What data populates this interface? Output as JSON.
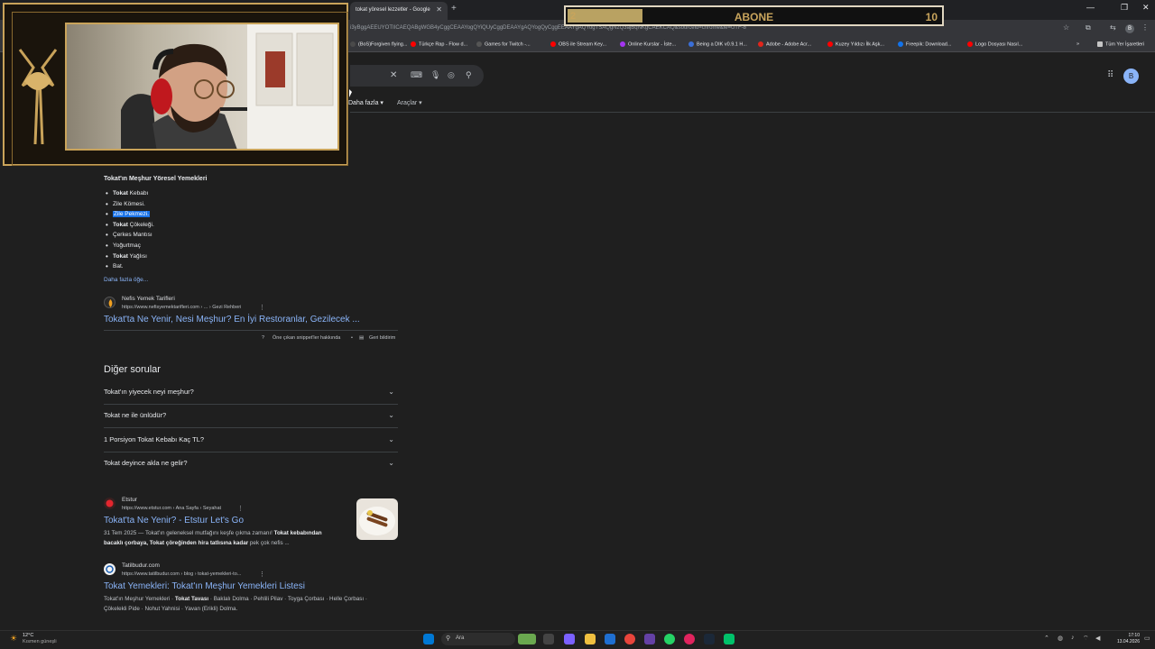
{
  "browser": {
    "tab_title": "tokat yöresel lezzetler - Google",
    "url": "i3yBggAEEUYOTIICAEQABgWGB4yCggCEAAYogQYiQUyCggDEAAYgAQYogQyCggEEAAYgAQYogTSAQgNzQ3ajBqNKgCAEKCAQ&sourceid=chrome&ie=UTF-8",
    "bookmarks": [
      {
        "label": "(BoS)Forgiven flying...",
        "color": "#4a4a4a"
      },
      {
        "label": "Türkçe Rap - Flow d...",
        "color": "#ff0000"
      },
      {
        "label": "Games for Twitch -...",
        "color": "#555555"
      },
      {
        "label": "OBS ile Stream Key...",
        "color": "#ff0000"
      },
      {
        "label": "Online Kurslar - İste...",
        "color": "#a435f0"
      },
      {
        "label": "Being a DIK v0.9.1 H...",
        "color": "#3a6fd8"
      },
      {
        "label": "Adobe - Adobe Acr...",
        "color": "#e1251b"
      },
      {
        "label": "Kuzey Yıldızı İlk Aşk...",
        "color": "#ff0000"
      },
      {
        "label": "Freepik: Download...",
        "color": "#1273eb"
      },
      {
        "label": "Logo Dosyası Nasıl...",
        "color": "#ff0000"
      }
    ],
    "all_bookmarks": "Tüm Yer İşaretleri",
    "profile_initial": "B"
  },
  "search": {
    "more_tab": "Daha fazla",
    "tools_tab": "Araçlar"
  },
  "overlay": {
    "sub_label": "ABONE",
    "sub_current": "2",
    "sub_goal": "10",
    "sub_progress": 0.2
  },
  "snippet": {
    "title": "Tokat'ın Meşhur Yöresel Yemekleri",
    "items": [
      {
        "bold": "Tokat",
        "rest": " Kebabı"
      },
      {
        "bold": "",
        "rest": "Zile Kömesi."
      },
      {
        "bold": "",
        "rest": "Zile Pekmezi."
      },
      {
        "bold": "Tokat",
        "rest": " Çökeleği."
      },
      {
        "bold": "",
        "rest": "Çerkes Mantısı"
      },
      {
        "bold": "",
        "rest": "Yoğurtmaç"
      },
      {
        "bold": "Tokat",
        "rest": " Yağlısı"
      },
      {
        "bold": "",
        "rest": "Bat."
      }
    ],
    "more_link": "Daha fazla öğe...",
    "source_name": "Nefis Yemek Tarifleri",
    "source_url": "https://www.nefisyemektarifleri.com › ... › Gezi Rehberi",
    "result_title": "Tokat'ta Ne Yenir, Nesi Meşhur? En İyi Restoranlar, Gezilecek ...",
    "about": "Öne çıkan snippet'ler hakkında",
    "feedback": "Geri bildirim"
  },
  "paa": {
    "title": "Diğer sorular",
    "questions": [
      "Tokat'ın yiyecek neyi meşhur?",
      "Tokat ne ile ünlüdür?",
      "1 Porsiyon Tokat Kebabı Kaç TL?",
      "Tokat deyince akla ne gelir?"
    ]
  },
  "results": [
    {
      "site": "Etstur",
      "url": "https://www.etstur.com › Ana Sayfa › Seyahat",
      "title": "Tokat'ta Ne Yenir? - Etstur Let's Go",
      "desc1_pre": "31 Tem 2025 — Tokat'ın geleneksel mutfağını keşfe çıkma zamanı! ",
      "desc1_bold": "Tokat kebabından",
      "desc2_bold": "bacaklı çorbaya, Tokat çöreğinden hira tatlısına kadar",
      "desc2_post": " pek çok nefis ..."
    },
    {
      "site": "Tatilbudur.com",
      "url": "https://www.tatilbudur.com › blog › tokat-yemekleri-to...",
      "title": "Tokat Yemekleri: Tokat'ın Meşhur Yemekleri Listesi",
      "desc1_pre": "Tokat'ın Meşhur Yemekleri · ",
      "desc1_bold": "Tokat Tavası",
      "desc1_post": " · Baklalı Dolma · Pehlili Pilav · Toyga Çorbası · Helle Çorbası ·",
      "desc2": "Çökelekli Pide · Nohut Yahnisi · Yavan (Erikli) Dolma."
    }
  ],
  "taskbar": {
    "temp": "12°C",
    "weather": "Kısmen güneşli",
    "search": "Ara",
    "time": "17:10",
    "date": "13.04.2026"
  }
}
